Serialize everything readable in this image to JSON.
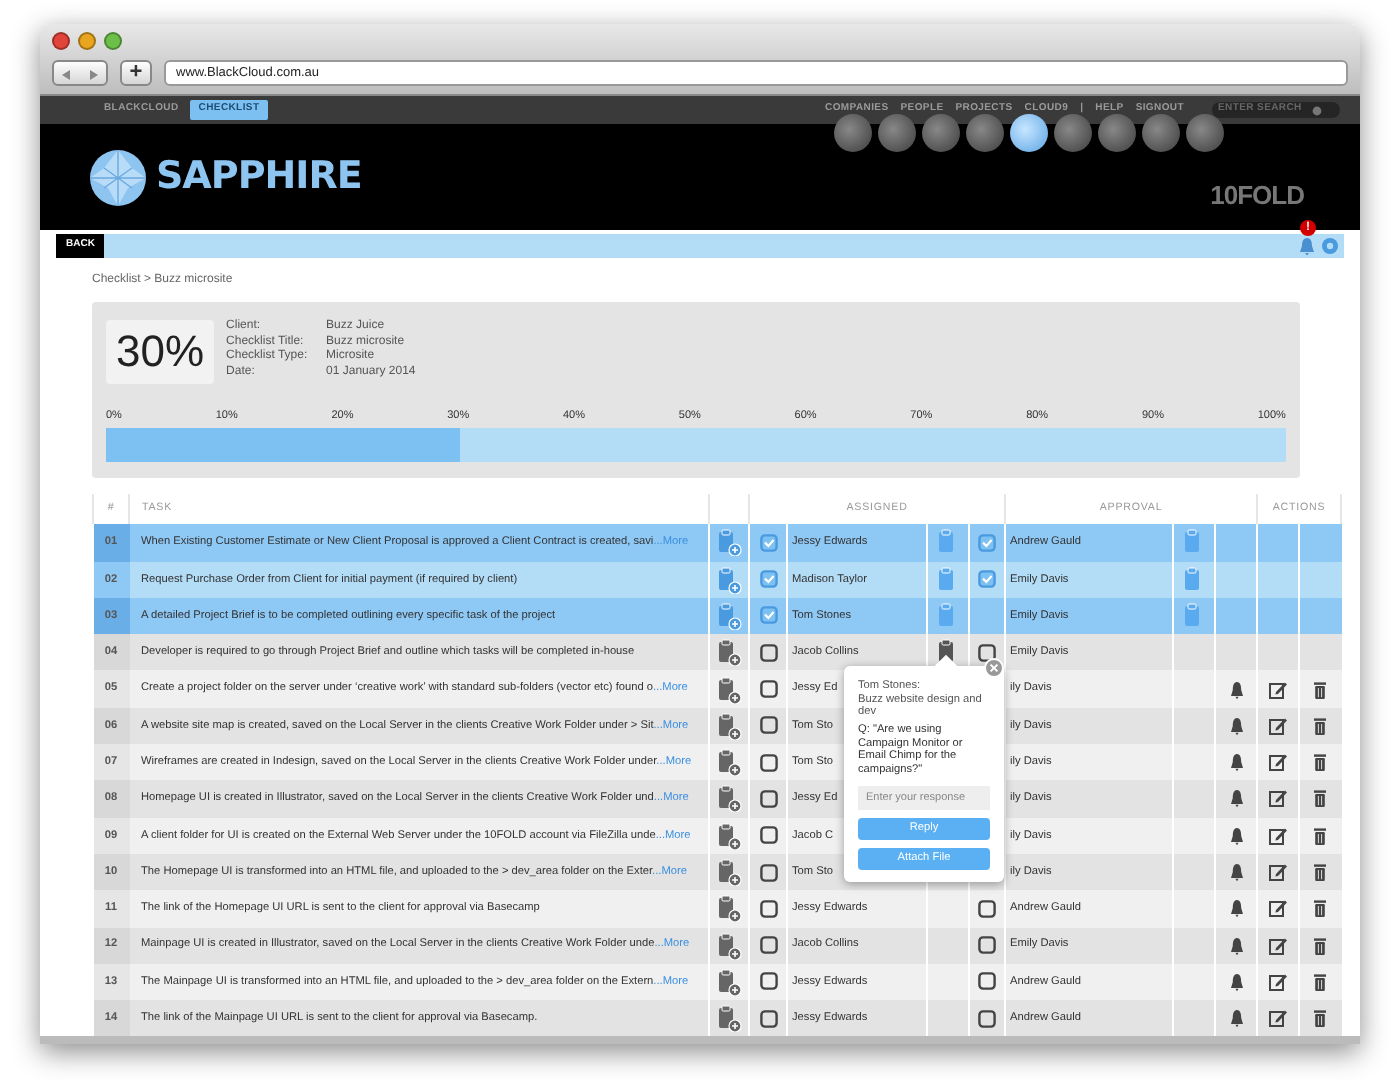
{
  "browser": {
    "url": "www.BlackCloud.com.au",
    "new_tab": "+"
  },
  "topnav": {
    "left": [
      {
        "label": "BLACKCLOUD",
        "selected": false
      },
      {
        "label": "CHECKLIST",
        "selected": true
      }
    ],
    "right": [
      "COMPANIES",
      "PEOPLE",
      "PROJECTS",
      "CLOUD9",
      "|",
      "HELP",
      "SIGNOUT"
    ],
    "search": {
      "placeholder": "ENTER SEARCH"
    }
  },
  "header": {
    "logo": "SAPPHIRE",
    "brand": "10FOLD",
    "thumbnails": [
      {
        "selected": false
      },
      {
        "selected": false
      },
      {
        "selected": false
      },
      {
        "selected": false
      },
      {
        "selected": true
      },
      {
        "selected": false
      },
      {
        "selected": false
      },
      {
        "selected": false
      },
      {
        "selected": false
      }
    ]
  },
  "toolbar": {
    "back": "BACK",
    "alert_badge": "!"
  },
  "breadcrumb": "Checklist > Buzz microsite",
  "summary": {
    "percent": "30%",
    "fields": [
      {
        "label": "Client:",
        "value": "Buzz Juice"
      },
      {
        "label": "Checklist Title:",
        "value": "Buzz microsite"
      },
      {
        "label": "Checklist Type:",
        "value": "Microsite"
      },
      {
        "label": "Date:",
        "value": "01 January 2014"
      }
    ],
    "ticks": [
      "0%",
      "10%",
      "20%",
      "30%",
      "40%",
      "50%",
      "60%",
      "70%",
      "80%",
      "90%",
      "100%"
    ],
    "level": 0.3
  },
  "table": {
    "columns": [
      "#",
      "TASK",
      "ASSIGNED",
      "APPROVAL",
      "ACTIONS"
    ],
    "rows": [
      {
        "num": "01",
        "task": "When Existing Customer Estimate or New Client Proposal is approved a Client Contract is created, savi",
        "more": "...More",
        "selected": true,
        "assigned": {
          "checked": true,
          "name": "Jessy Edwards",
          "note": true
        },
        "approval": {
          "checked": true,
          "name": "Andrew Gauld",
          "note": true
        },
        "actions": false
      },
      {
        "num": "02",
        "task": "Request Purchase Order from Client for initial payment (if required by client)",
        "selected": true,
        "assigned": {
          "checked": true,
          "name": "Madison Taylor",
          "note": true
        },
        "approval": {
          "checked": true,
          "name": "Emily Davis",
          "note": true
        },
        "actions": false
      },
      {
        "num": "03",
        "task": "A detailed Project Brief is to be completed outlining every specific task of the project",
        "selected": true,
        "assigned": {
          "checked": true,
          "name": "Tom Stones",
          "note": true
        },
        "approval": {
          "name": "Emily Davis",
          "note": true
        },
        "actions": false
      },
      {
        "num": "04",
        "task": "Developer is required to go through Project Brief and outline which tasks will be completed in-house",
        "selected": false,
        "assigned": {
          "checked": false,
          "name": "Jacob Collins",
          "note": true
        },
        "approval": {
          "checked": false,
          "name": "Emily Davis",
          "note": false
        },
        "actions": false
      },
      {
        "num": "05",
        "task": "Create a project folder on the server under ‘creative work’ with standard sub-folders (vector etc) found o",
        "more": "...More",
        "selected": false,
        "assigned": {
          "checked": false,
          "name": "Jessy Ed",
          "note": false
        },
        "approval": {
          "name": "ily Davis",
          "note": false
        },
        "actions": true
      },
      {
        "num": "06",
        "task": "A website site map is created, saved on the Local Server in the clients Creative Work Folder under > Sit",
        "more": "...More",
        "selected": false,
        "assigned": {
          "checked": false,
          "name": "Tom Sto",
          "note": false
        },
        "approval": {
          "name": "ily Davis",
          "note": false
        },
        "actions": true
      },
      {
        "num": "07",
        "task": "Wireframes are created in Indesign, saved on the Local Server in the clients Creative Work Folder under",
        "more": "...More",
        "selected": false,
        "assigned": {
          "checked": false,
          "name": "Tom Sto",
          "note": false
        },
        "approval": {
          "name": "ily Davis",
          "note": false
        },
        "actions": true
      },
      {
        "num": "08",
        "task": "Homepage UI is created in Illustrator, saved on the Local Server in the clients Creative Work Folder und",
        "more": "...More",
        "selected": false,
        "assigned": {
          "checked": false,
          "name": "Jessy Ed",
          "note": false
        },
        "approval": {
          "name": "ily Davis",
          "note": false
        },
        "actions": true
      },
      {
        "num": "09",
        "task": "A client folder for UI is created on the External Web Server under the 10FOLD account via FileZilla unde",
        "more": "...More",
        "selected": false,
        "assigned": {
          "checked": false,
          "name": "Jacob C",
          "note": false
        },
        "approval": {
          "name": "ily Davis",
          "note": false
        },
        "actions": true
      },
      {
        "num": "10",
        "task": "The Homepage UI is transformed into an HTML file, and uploaded to the > dev_area folder on the Exter",
        "more": "...More",
        "selected": false,
        "assigned": {
          "checked": false,
          "name": "Tom Sto",
          "note": false
        },
        "approval": {
          "name": "ily Davis",
          "note": false
        },
        "actions": true
      },
      {
        "num": "11",
        "task": "The link of the Homepage UI URL is sent to the client for approval via Basecamp",
        "selected": false,
        "assigned": {
          "checked": false,
          "name": "Jessy Edwards",
          "note": false
        },
        "approval": {
          "checked": false,
          "name": "Andrew Gauld",
          "note": false
        },
        "actions": true
      },
      {
        "num": "12",
        "task": "Mainpage UI is created in Illustrator, saved on the Local Server in the clients Creative Work Folder unde",
        "more": "...More",
        "selected": false,
        "assigned": {
          "checked": false,
          "name": "Jacob Collins",
          "note": false
        },
        "approval": {
          "checked": false,
          "name": "Emily Davis",
          "note": false
        },
        "actions": true
      },
      {
        "num": "13",
        "task": "The Mainpage UI is transformed into an HTML file, and uploaded to the > dev_area folder on the Extern",
        "more": "...More",
        "selected": false,
        "assigned": {
          "checked": false,
          "name": "Jessy Edwards",
          "note": false
        },
        "approval": {
          "checked": false,
          "name": "Andrew Gauld",
          "note": false
        },
        "actions": true
      },
      {
        "num": "14",
        "task": "The link of the Mainpage UI URL is sent to the client for approval via Basecamp.",
        "selected": false,
        "assigned": {
          "checked": false,
          "name": "Jessy Edwards",
          "note": false
        },
        "approval": {
          "checked": false,
          "name": "Andrew Gauld",
          "note": false
        },
        "actions": true
      }
    ]
  },
  "popover": {
    "author": "Tom Stones:",
    "project": "Buzz website design and dev",
    "question": "Q: \"Are we using Campaign Monitor or Email Chimp for the campaigns?\"",
    "placeholder": "Enter your response",
    "buttons": [
      "Reply",
      "Attach File"
    ]
  }
}
